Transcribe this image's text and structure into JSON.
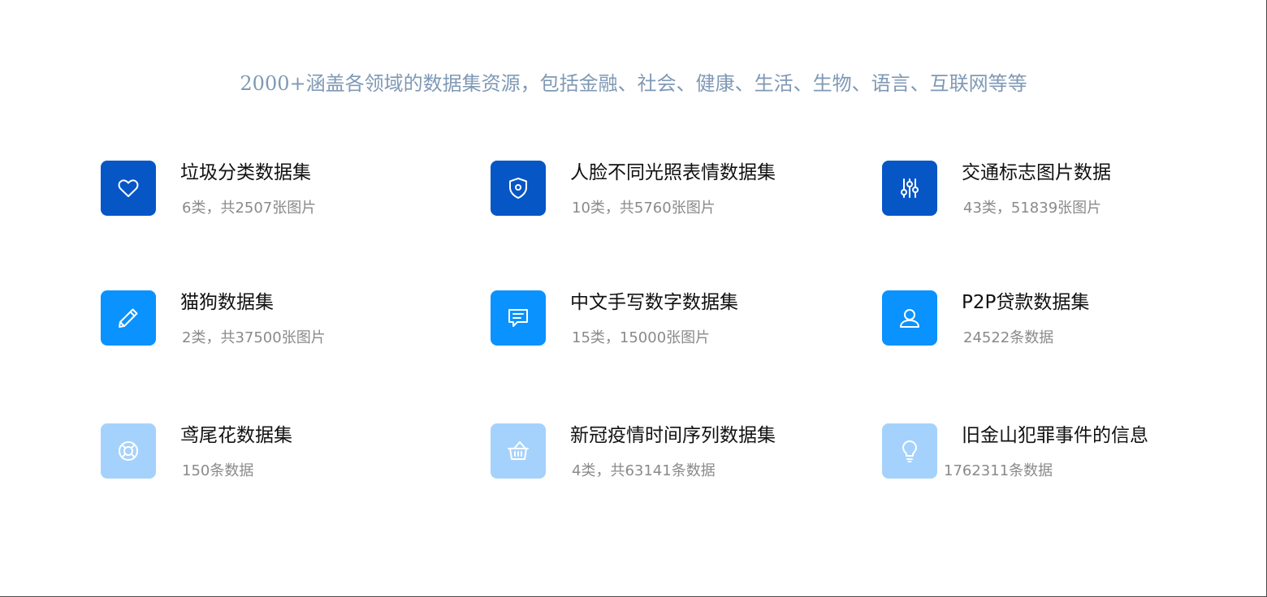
{
  "headline": "2000+涵盖各领域的数据集资源，包括金融、社会、健康、生活、生物、语言、互联网等等",
  "colors": {
    "headline": "#7f99b5",
    "icon_dark": "#0656c6",
    "icon_mid": "#0a92ff",
    "icon_light": "#a5d2fc",
    "title": "#111111",
    "desc": "#8a8a8a"
  },
  "datasets": [
    {
      "title": "垃圾分类数据集",
      "desc": "6类，共2507张图片",
      "icon": "heart-icon"
    },
    {
      "title": "人脸不同光照表情数据集",
      "desc": "10类，共5760张图片",
      "icon": "shield-icon"
    },
    {
      "title": "交通标志图片数据",
      "desc": "43类，51839张图片",
      "icon": "sliders-icon"
    },
    {
      "title": "猫狗数据集",
      "desc": "2类，共37500张图片",
      "icon": "pencil-icon"
    },
    {
      "title": "中文手写数字数据集",
      "desc": "15类，15000张图片",
      "icon": "message-icon"
    },
    {
      "title": "P2P贷款数据集",
      "desc": "24522条数据",
      "icon": "user-icon"
    },
    {
      "title": "鸢尾花数据集",
      "desc": "150条数据",
      "icon": "lifebuoy-icon"
    },
    {
      "title": "新冠疫情时间序列数据集",
      "desc": "4类，共63141条数据",
      "icon": "basket-icon"
    },
    {
      "title": "旧金山犯罪事件的信息",
      "desc": "1762311条数据",
      "icon": "lightbulb-icon"
    }
  ]
}
